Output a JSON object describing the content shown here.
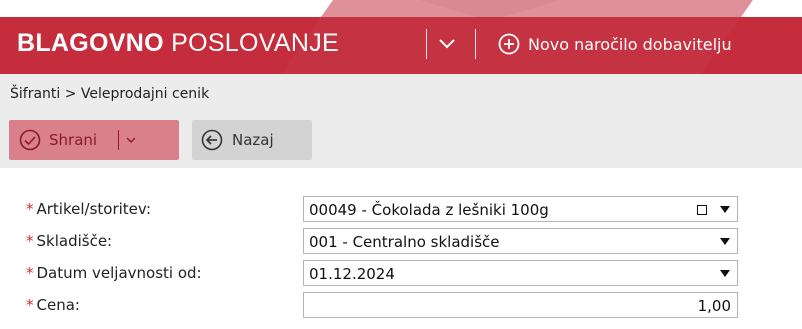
{
  "header": {
    "brand_bold": "BLAGOVNO",
    "brand_light": "POSLOVANJE",
    "new_order_label": "Novo naročilo dobavitelju",
    "bg_color": "#c52d3c"
  },
  "breadcrumb": "Šifranti > Veleprodajni cenik",
  "toolbar": {
    "save_label": "Shrani",
    "back_label": "Nazaj"
  },
  "form": {
    "required_mark": "*",
    "fields": [
      {
        "label": "Artikel/storitev:",
        "value": "00049 - Čokolada z lešniki 100g"
      },
      {
        "label": "Skladišče:",
        "value": "001 - Centralno skladišče"
      },
      {
        "label": "Datum veljavnosti od:",
        "value": "01.12.2024"
      },
      {
        "label": "Cena:",
        "value": "1,00"
      }
    ]
  }
}
